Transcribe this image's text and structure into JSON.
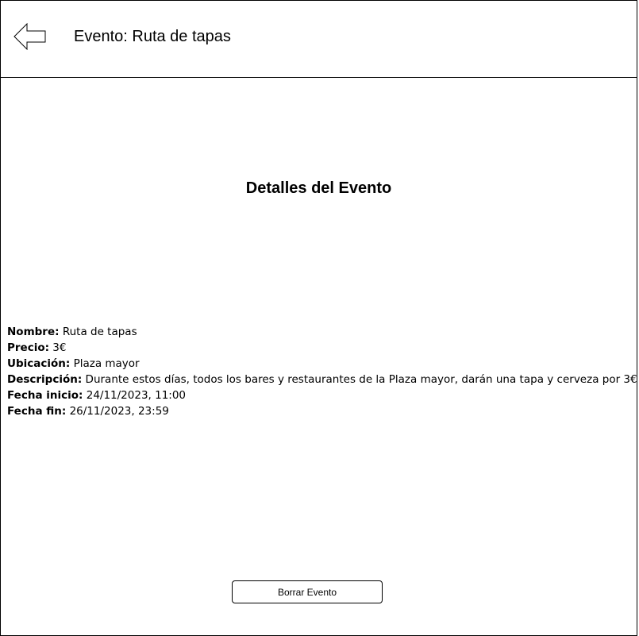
{
  "header": {
    "back_icon": "arrow-left-icon",
    "title": "Evento: Ruta de tapas"
  },
  "main": {
    "section_title": "Detalles del Evento",
    "details": [
      {
        "label": "Nombre:",
        "value": " Ruta de tapas"
      },
      {
        "label": "Precio:",
        "value": " 3€"
      },
      {
        "label": "Ubicación:",
        "value": " Plaza mayor"
      },
      {
        "label": "Descripción:",
        "value": " Durante estos días, todos los bares y restaurantes de la Plaza mayor, darán una tapa y cerveza por 3€"
      },
      {
        "label": "Fecha inicio:",
        "value": " 24/11/2023, 11:00"
      },
      {
        "label": "Fecha fin:",
        "value": " 26/11/2023, 23:59"
      }
    ],
    "delete_button_label": "Borrar Evento"
  }
}
